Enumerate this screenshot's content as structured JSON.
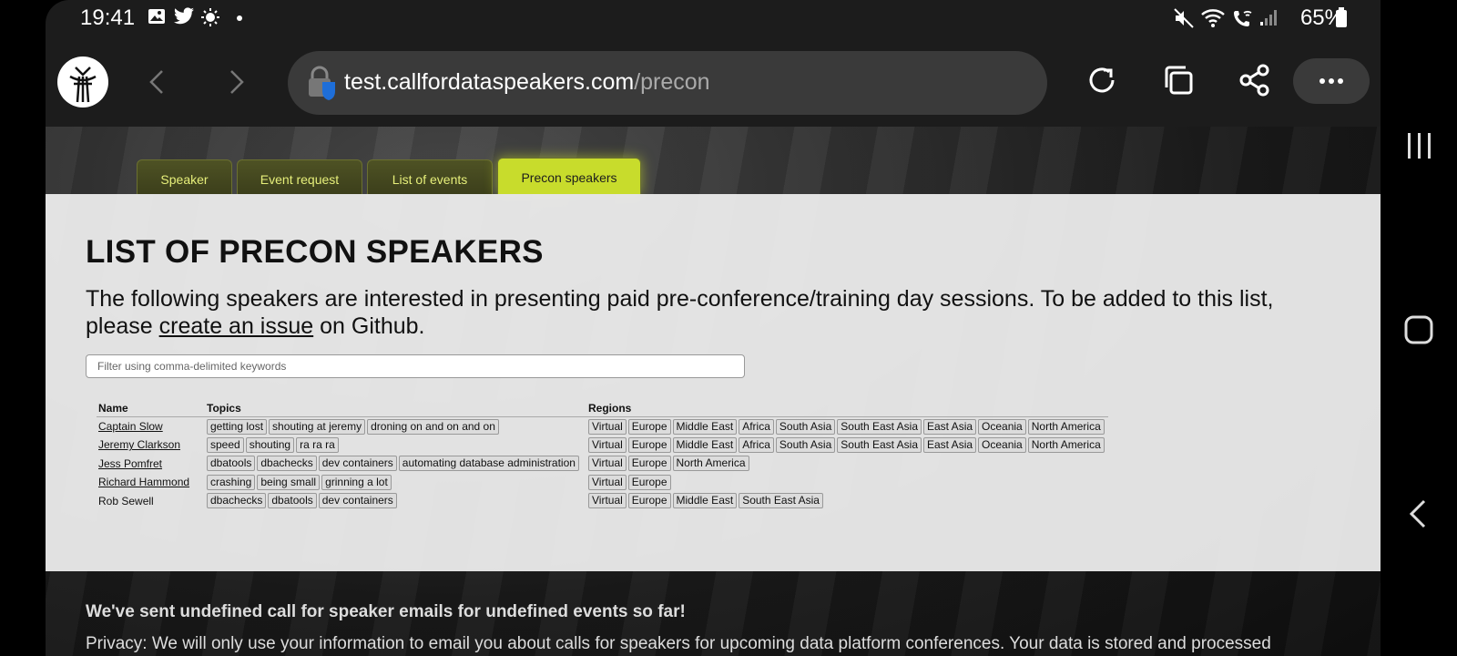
{
  "status_bar": {
    "time": "19:41",
    "battery": "65%",
    "icons": [
      "gallery-icon",
      "twitter-icon",
      "brightness-icon",
      "dot-icon",
      "mute-icon",
      "wifi-icon",
      "wifi-call-icon",
      "signal-icon",
      "battery-icon"
    ]
  },
  "browser": {
    "url_host": "test.callfordataspeakers.com",
    "url_path": "/precon",
    "buttons": [
      "back-icon",
      "forward-icon",
      "reload-icon",
      "tabs-icon",
      "share-icon",
      "more-icon"
    ]
  },
  "tabs": [
    {
      "label": "Speaker",
      "active": false
    },
    {
      "label": "Event request",
      "active": false
    },
    {
      "label": "List of events",
      "active": false
    },
    {
      "label": "Precon speakers",
      "active": true
    }
  ],
  "main": {
    "title": "LIST OF PRECON SPEAKERS",
    "intro_before": "The following speakers are interested in presenting paid pre-conference/training day sessions. To be added to this list, please ",
    "intro_link": "create an issue",
    "intro_after": " on Github.",
    "filter_placeholder": "Filter using comma-delimited keywords",
    "table": {
      "headers": {
        "name": "Name",
        "topics": "Topics",
        "regions": "Regions"
      },
      "rows": [
        {
          "name": "Captain Slow",
          "linked": true,
          "topics": [
            "getting lost",
            "shouting at jeremy",
            "droning on and on and on"
          ],
          "regions": [
            "Virtual",
            "Europe",
            "Middle East",
            "Africa",
            "South Asia",
            "South East Asia",
            "East Asia",
            "Oceania",
            "North America"
          ]
        },
        {
          "name": "Jeremy Clarkson",
          "linked": true,
          "topics": [
            "speed",
            "shouting",
            "ra ra ra"
          ],
          "regions": [
            "Virtual",
            "Europe",
            "Middle East",
            "Africa",
            "South Asia",
            "South East Asia",
            "East Asia",
            "Oceania",
            "North America"
          ]
        },
        {
          "name": "Jess Pomfret",
          "linked": true,
          "topics": [
            "dbatools",
            "dbachecks",
            "dev containers",
            "automating database administration"
          ],
          "regions": [
            "Virtual",
            "Europe",
            "North America"
          ]
        },
        {
          "name": "Richard Hammond",
          "linked": true,
          "topics": [
            "crashing",
            "being small",
            "grinning a lot"
          ],
          "regions": [
            "Virtual",
            "Europe"
          ]
        },
        {
          "name": "Rob Sewell",
          "linked": false,
          "topics": [
            "dbachecks",
            "dbatools",
            "dev containers"
          ],
          "regions": [
            "Virtual",
            "Europe",
            "Middle East",
            "South East Asia"
          ]
        }
      ]
    }
  },
  "footer": {
    "heading": "We've sent undefined call for speaker emails for undefined events so far!",
    "privacy": "Privacy: We will only use your information to email you about calls for speakers for upcoming data platform conferences. Your data is stored and processed"
  },
  "colors": {
    "tab_active": "#c8dc2c",
    "tab_inactive_text": "#e6ef7a",
    "content_bg": "#ececec"
  }
}
